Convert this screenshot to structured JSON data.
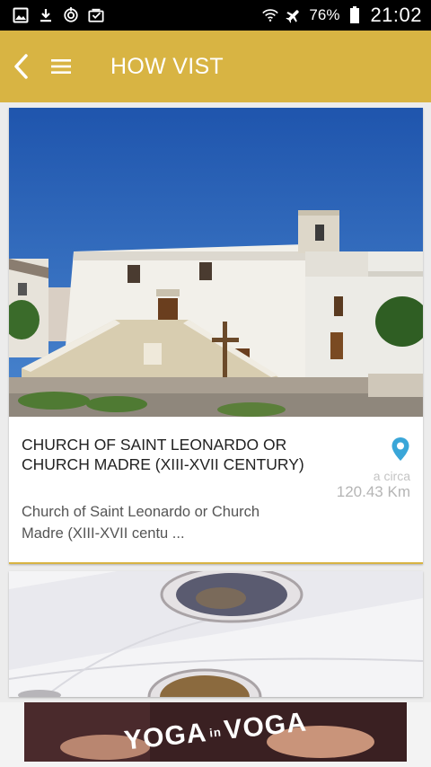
{
  "status": {
    "battery": "76%",
    "time": "21:02"
  },
  "header": {
    "title": "HOW VIST"
  },
  "place": {
    "title": "CHURCH OF SAINT LEONARDO OR CHURCH MADRE (XIII-XVII CENTURY)",
    "distance_label": "a circa",
    "distance": "120.43 Km",
    "description": "Church of Saint Leonardo or Church Madre (XIII-XVII centu ..."
  },
  "ad": {
    "word1": "YOGA",
    "small": "in",
    "word2": "VOGA"
  },
  "colors": {
    "accent": "#d8b443",
    "pin": "#3aa6d8"
  },
  "icons": [
    "gallery-icon",
    "download-icon",
    "sync-icon",
    "inbox-icon",
    "wifi-icon",
    "airplane-icon",
    "battery-icon",
    "back-icon",
    "hamburger-icon",
    "location-pin-icon"
  ]
}
